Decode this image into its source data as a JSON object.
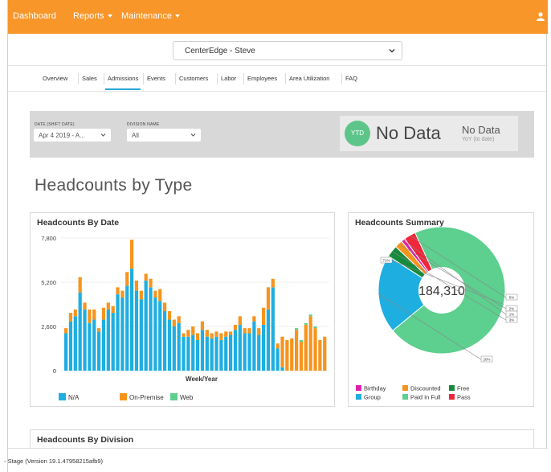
{
  "nav": {
    "dashboard": "Dashboard",
    "reports": "Reports",
    "maintenance": "Maintenance"
  },
  "company_select": {
    "value": "CenterEdge - Steve"
  },
  "tabs": [
    "Overview",
    "Sales",
    "Admissions",
    "Events",
    "Customers",
    "Labor",
    "Employees",
    "Area Utilization",
    "FAQ"
  ],
  "active_tab": "Admissions",
  "filters": {
    "date_label": "DATE (SHIFT DATE)",
    "date_value": "Apr 4 2019 - A...",
    "division_label": "DIVISION NAME",
    "division_value": "All"
  },
  "ytd": {
    "badge": "YTD",
    "value": "No Data",
    "yoy_value": "No Data",
    "yoy_label": "YoY (to date)"
  },
  "section_title": "Headcounts by Type",
  "headcounts_by_date": {
    "title": "Headcounts By Date",
    "xlabel": "Week/Year",
    "legend": [
      {
        "name": "N/A",
        "color": "#1faee0"
      },
      {
        "name": "On-Premise",
        "color": "#f7941d"
      },
      {
        "name": "Web",
        "color": "#5dcf8f"
      }
    ]
  },
  "headcounts_summary": {
    "title": "Headcounts Summary",
    "total": "184,310",
    "legend": [
      {
        "name": "Birthday",
        "color": "#e11fae"
      },
      {
        "name": "Discounted",
        "color": "#f7941d"
      },
      {
        "name": "Free",
        "color": "#178a3c"
      },
      {
        "name": "Group",
        "color": "#1faee0"
      },
      {
        "name": "Paid In Full",
        "color": "#5dcf8f"
      },
      {
        "name": "Pass",
        "color": "#f0263a"
      }
    ]
  },
  "division_card": {
    "title": "Headcounts By Division"
  },
  "footer": {
    "text": "- Stage (Version 19.1.47958215afb9)"
  },
  "chart_data": [
    {
      "type": "bar",
      "title": "Headcounts By Date",
      "xlabel": "Week/Year",
      "ylabel": "",
      "ylim": [
        0,
        7800
      ],
      "yticks": [
        "0",
        "2,600",
        "5,200",
        "7,800"
      ],
      "stacked": true,
      "series": [
        {
          "name": "N/A",
          "values": [
            2200,
            2900,
            3200,
            4600,
            3600,
            2800,
            3000,
            2300,
            3000,
            3600,
            3400,
            4500,
            4300,
            5000,
            6000,
            4700,
            4200,
            5300,
            4900,
            4300,
            4100,
            3500,
            3000,
            2600,
            2800,
            2000,
            2000,
            2100,
            1800,
            2400,
            2000,
            1900,
            2000,
            1800,
            2000,
            2100,
            2400,
            2700,
            2200,
            2200,
            2900,
            2100,
            2700,
            3600,
            4900,
            1300,
            200,
            0,
            0,
            0,
            0,
            0,
            0,
            0,
            0,
            0
          ]
        },
        {
          "name": "On-Premise",
          "values": [
            300,
            500,
            400,
            900,
            400,
            800,
            600,
            200,
            700,
            400,
            400,
            400,
            400,
            800,
            1700,
            600,
            500,
            400,
            500,
            400,
            700,
            500,
            500,
            400,
            400,
            200,
            400,
            500,
            400,
            500,
            400,
            300,
            300,
            400,
            300,
            200,
            300,
            500,
            300,
            300,
            300,
            400,
            1000,
            1300,
            500,
            300,
            1800,
            1800,
            1900,
            2400,
            1700,
            2700,
            3200,
            2500,
            1800,
            2000
          ]
        },
        {
          "name": "Web",
          "values": [
            0,
            0,
            0,
            0,
            0,
            0,
            0,
            0,
            0,
            0,
            0,
            0,
            0,
            0,
            0,
            0,
            0,
            0,
            0,
            0,
            0,
            0,
            0,
            0,
            0,
            0,
            0,
            0,
            0,
            0,
            0,
            0,
            0,
            0,
            0,
            0,
            0,
            0,
            0,
            0,
            0,
            0,
            0,
            0,
            0,
            0,
            0,
            0,
            0,
            100,
            100,
            100,
            100,
            100,
            0,
            0
          ]
        }
      ]
    },
    {
      "type": "pie",
      "title": "Headcounts Summary",
      "categories": [
        "Paid In Full",
        "Group",
        "Free",
        "Discounted",
        "Birthday",
        "Pass"
      ],
      "values": [
        71,
        20,
        3,
        2,
        1,
        3
      ],
      "labels": [
        "71%",
        "20%",
        "3%",
        "2%",
        "1%",
        "5%"
      ]
    }
  ]
}
